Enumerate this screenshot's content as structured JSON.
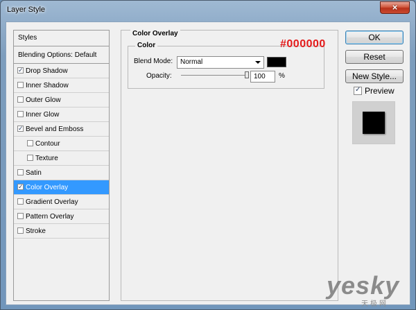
{
  "window": {
    "title": "Layer Style",
    "close_symbol": "×"
  },
  "styles_panel": {
    "header": "Styles",
    "blending": "Blending Options: Default",
    "items": [
      {
        "label": "Drop Shadow",
        "checked": true,
        "indent": false,
        "selected": false
      },
      {
        "label": "Inner Shadow",
        "checked": false,
        "indent": false,
        "selected": false
      },
      {
        "label": "Outer Glow",
        "checked": false,
        "indent": false,
        "selected": false
      },
      {
        "label": "Inner Glow",
        "checked": false,
        "indent": false,
        "selected": false
      },
      {
        "label": "Bevel and Emboss",
        "checked": true,
        "indent": false,
        "selected": false
      },
      {
        "label": "Contour",
        "checked": false,
        "indent": true,
        "selected": false
      },
      {
        "label": "Texture",
        "checked": false,
        "indent": true,
        "selected": false
      },
      {
        "label": "Satin",
        "checked": false,
        "indent": false,
        "selected": false
      },
      {
        "label": "Color Overlay",
        "checked": true,
        "indent": false,
        "selected": true
      },
      {
        "label": "Gradient Overlay",
        "checked": false,
        "indent": false,
        "selected": false
      },
      {
        "label": "Pattern Overlay",
        "checked": false,
        "indent": false,
        "selected": false
      },
      {
        "label": "Stroke",
        "checked": false,
        "indent": false,
        "selected": false
      }
    ]
  },
  "color_overlay": {
    "group_title": "Color Overlay",
    "sub_title": "Color",
    "blend_mode_label": "Blend Mode:",
    "blend_mode_value": "Normal",
    "color": "#000000",
    "color_annotation": "#000000",
    "opacity_label": "Opacity:",
    "opacity_value": "100",
    "opacity_unit": "%",
    "opacity_fraction": 1.0
  },
  "buttons": {
    "ok": "OK",
    "reset": "Reset",
    "new_style": "New Style..."
  },
  "preview": {
    "label": "Preview",
    "checked": true
  },
  "watermark": {
    "text": "yesky",
    "sub": "天极网"
  },
  "colors": {
    "selection": "#3399ff",
    "annotation": "#e31b1b"
  }
}
